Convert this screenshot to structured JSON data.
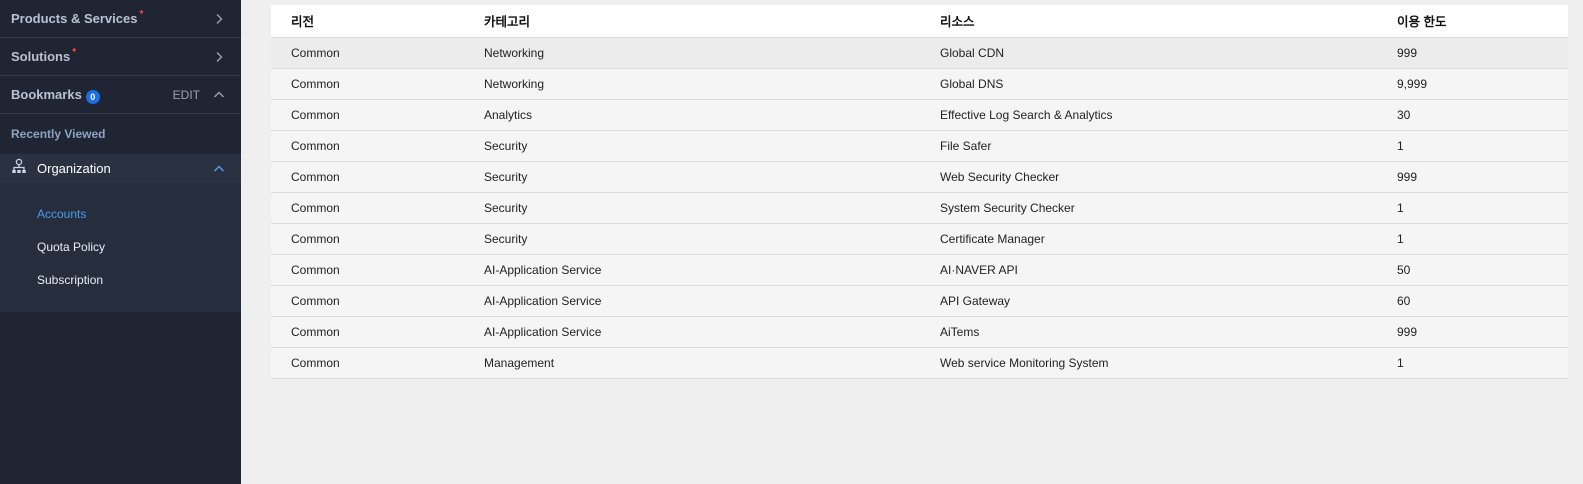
{
  "sidebar": {
    "products_label": "Products & Services",
    "solutions_label": "Solutions",
    "new_marker": "*",
    "bookmarks_label": "Bookmarks",
    "bookmarks_count": "0",
    "edit_label": "EDIT",
    "recent_label": "Recently Viewed",
    "organization_label": "Organization",
    "sub_items": [
      "Accounts",
      "Quota Policy",
      "Subscription"
    ]
  },
  "table": {
    "headers": [
      "리전",
      "카테고리",
      "리소스",
      "이용 한도"
    ],
    "rows": [
      [
        "Common",
        "Networking",
        "Global CDN",
        "999"
      ],
      [
        "Common",
        "Networking",
        "Global DNS",
        "9,999"
      ],
      [
        "Common",
        "Analytics",
        "Effective Log Search & Analytics",
        "30"
      ],
      [
        "Common",
        "Security",
        "File Safer",
        "1"
      ],
      [
        "Common",
        "Security",
        "Web Security Checker",
        "999"
      ],
      [
        "Common",
        "Security",
        "System Security Checker",
        "1"
      ],
      [
        "Common",
        "Security",
        "Certificate Manager",
        "1"
      ],
      [
        "Common",
        "AI-Application Service",
        "AI·NAVER API",
        "50"
      ],
      [
        "Common",
        "AI-Application Service",
        "API Gateway",
        "60"
      ],
      [
        "Common",
        "AI-Application Service",
        "AiTems",
        "999"
      ],
      [
        "Common",
        "Management",
        "Web service Monitoring System",
        "1"
      ]
    ]
  },
  "colors": {
    "sidebar_bg": "#1f2532",
    "active_link": "#4a9df0",
    "badge": "#1a6fe8",
    "new_marker": "#ff4a4a"
  }
}
